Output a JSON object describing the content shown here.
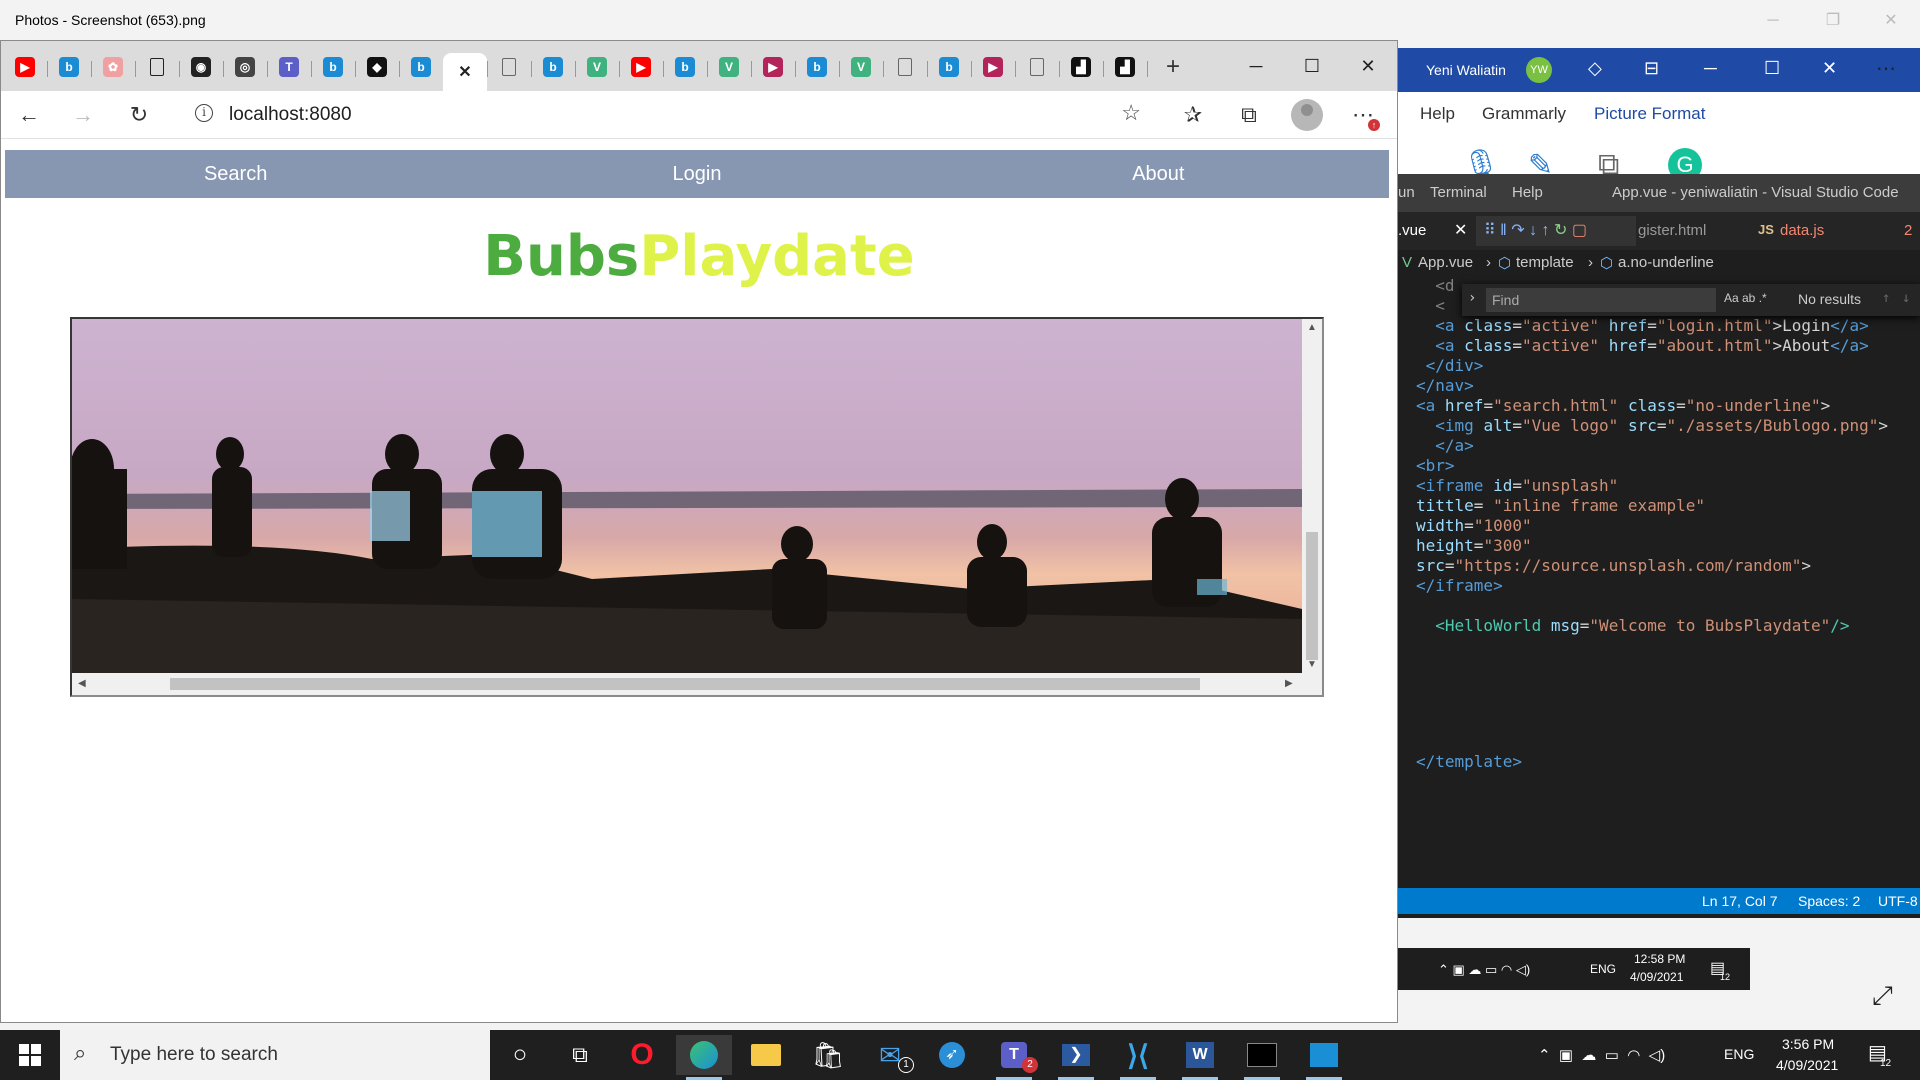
{
  "photos_app": {
    "title": "Photos - Screenshot (653).png"
  },
  "browser": {
    "address": "localhost:8080",
    "tabs": [
      {
        "icon": "youtube-icon",
        "color": "#ff0000",
        "glyph": "▶"
      },
      {
        "icon": "bing-icon",
        "color": "#1b8bd4",
        "glyph": "b"
      },
      {
        "icon": "image-icon",
        "color": "#f0a0a0",
        "glyph": "✿"
      },
      {
        "icon": "page-icon",
        "color": "#222222",
        "glyph": "◧"
      },
      {
        "icon": "github-icon",
        "color": "#222222",
        "glyph": "◉"
      },
      {
        "icon": "record-icon",
        "color": "#444444",
        "glyph": "◎"
      },
      {
        "icon": "teams-icon",
        "color": "#5b5fc7",
        "glyph": "T"
      },
      {
        "icon": "bing-icon",
        "color": "#1b8bd4",
        "glyph": "b"
      },
      {
        "icon": "figma-icon",
        "color": "#111111",
        "glyph": "◆"
      },
      {
        "icon": "bing-icon",
        "color": "#1b8bd4",
        "glyph": "b"
      },
      {
        "icon": "close-icon",
        "color": "#222222",
        "glyph": "✕"
      },
      {
        "icon": "page-icon",
        "color": "#666666",
        "glyph": "▯"
      },
      {
        "icon": "bing-icon",
        "color": "#1b8bd4",
        "glyph": "b"
      },
      {
        "icon": "vue-icon",
        "color": "#3fb27f",
        "glyph": "V"
      },
      {
        "icon": "youtube-icon",
        "color": "#ff0000",
        "glyph": "▶"
      },
      {
        "icon": "bing-icon",
        "color": "#1b8bd4",
        "glyph": "b"
      },
      {
        "icon": "vue-icon",
        "color": "#3fb27f",
        "glyph": "V"
      },
      {
        "icon": "power-apps-icon",
        "color": "#b3245b",
        "glyph": "▶"
      },
      {
        "icon": "bing-icon",
        "color": "#1b8bd4",
        "glyph": "b"
      },
      {
        "icon": "vue-icon",
        "color": "#3fb27f",
        "glyph": "V"
      },
      {
        "icon": "page-icon",
        "color": "#666666",
        "glyph": "▯"
      },
      {
        "icon": "bing-icon",
        "color": "#1b8bd4",
        "glyph": "b"
      },
      {
        "icon": "power-apps-icon",
        "color": "#b3245b",
        "glyph": "▶"
      },
      {
        "icon": "page-icon",
        "color": "#666666",
        "glyph": "▯"
      },
      {
        "icon": "inbox-icon",
        "color": "#111111",
        "glyph": "▟"
      },
      {
        "icon": "inbox-icon",
        "color": "#111111",
        "glyph": "▟"
      }
    ],
    "new_tab": "+"
  },
  "page": {
    "nav": [
      "Search",
      "Login",
      "About"
    ],
    "logo_part1": "Bubs",
    "logo_part2": "Playdate",
    "colors": {
      "nav_bg": "#8797b1",
      "logo_green": "#4dac3f",
      "logo_yellow": "#dff24a"
    }
  },
  "vscode": {
    "user": "Yeni Waliatin",
    "user_initials": "YW",
    "ribbon_menu": [
      "Help",
      "Grammarly",
      "Picture Format"
    ],
    "menu": [
      "un",
      "Terminal",
      "Help"
    ],
    "window_title": "App.vue - yeniwaliatin - Visual Studio Code",
    "tabs": ".vue",
    "tab2": "gister.html",
    "tab3": "data.js",
    "tab3_count": "2",
    "breadcrumb": [
      "App.vue",
      "template",
      "a.no-underline"
    ],
    "find_placeholder": "Find",
    "find_result": "No results",
    "status": {
      "position": "Ln 17, Col 7",
      "spaces": "Spaces: 2",
      "encoding": "UTF-8"
    },
    "mini_time": "12:58 PM",
    "mini_date": "4/09/2021",
    "mini_lang": "ENG",
    "mini_notif": "12"
  },
  "taskbar": {
    "search_placeholder": "Type here to search",
    "lang": "ENG",
    "time": "3:56 PM",
    "date": "4/09/2021",
    "notif_count": "12",
    "mail_badge": "1",
    "teams_badge": "2"
  }
}
